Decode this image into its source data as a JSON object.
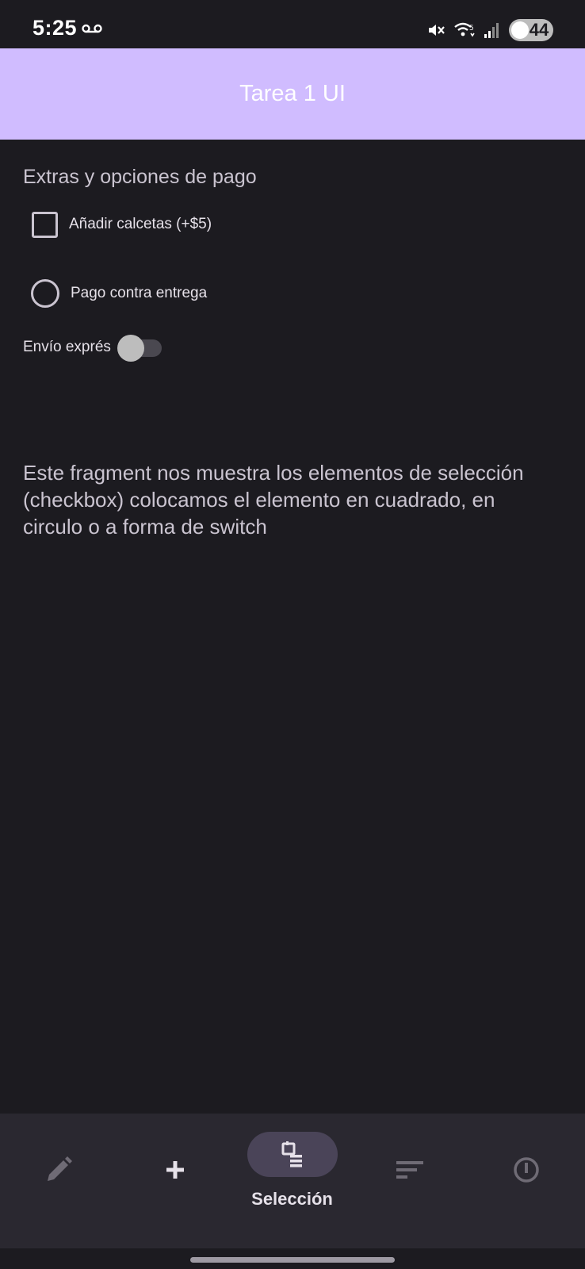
{
  "status_bar": {
    "time": "5:25",
    "battery_level": "44",
    "icons": [
      "voicemail-icon",
      "mute-icon",
      "wifi-icon",
      "signal-icon",
      "battery-icon"
    ]
  },
  "app_bar": {
    "title": "Tarea 1 UI",
    "color": "#d0bcff"
  },
  "content": {
    "section_title": "Extras y opciones de pago",
    "checkbox": {
      "label": "Añadir calcetas (+$5)",
      "checked": false
    },
    "radio": {
      "label": "Pago contra entrega",
      "selected": false
    },
    "switch": {
      "label": "Envío exprés",
      "on": false
    },
    "description": "Este fragment nos muestra los elementos de selección (checkbox) colocamos el elemento en cuadrado, en circulo o a forma de switch"
  },
  "bottom_nav": {
    "items": [
      {
        "icon": "pencil-icon",
        "label": "",
        "active": false
      },
      {
        "icon": "plus-icon",
        "label": "",
        "active": false
      },
      {
        "icon": "selection-icon",
        "label": "Selección",
        "active": true
      },
      {
        "icon": "sort-icon",
        "label": "",
        "active": false
      },
      {
        "icon": "power-icon",
        "label": "",
        "active": false
      }
    ]
  }
}
